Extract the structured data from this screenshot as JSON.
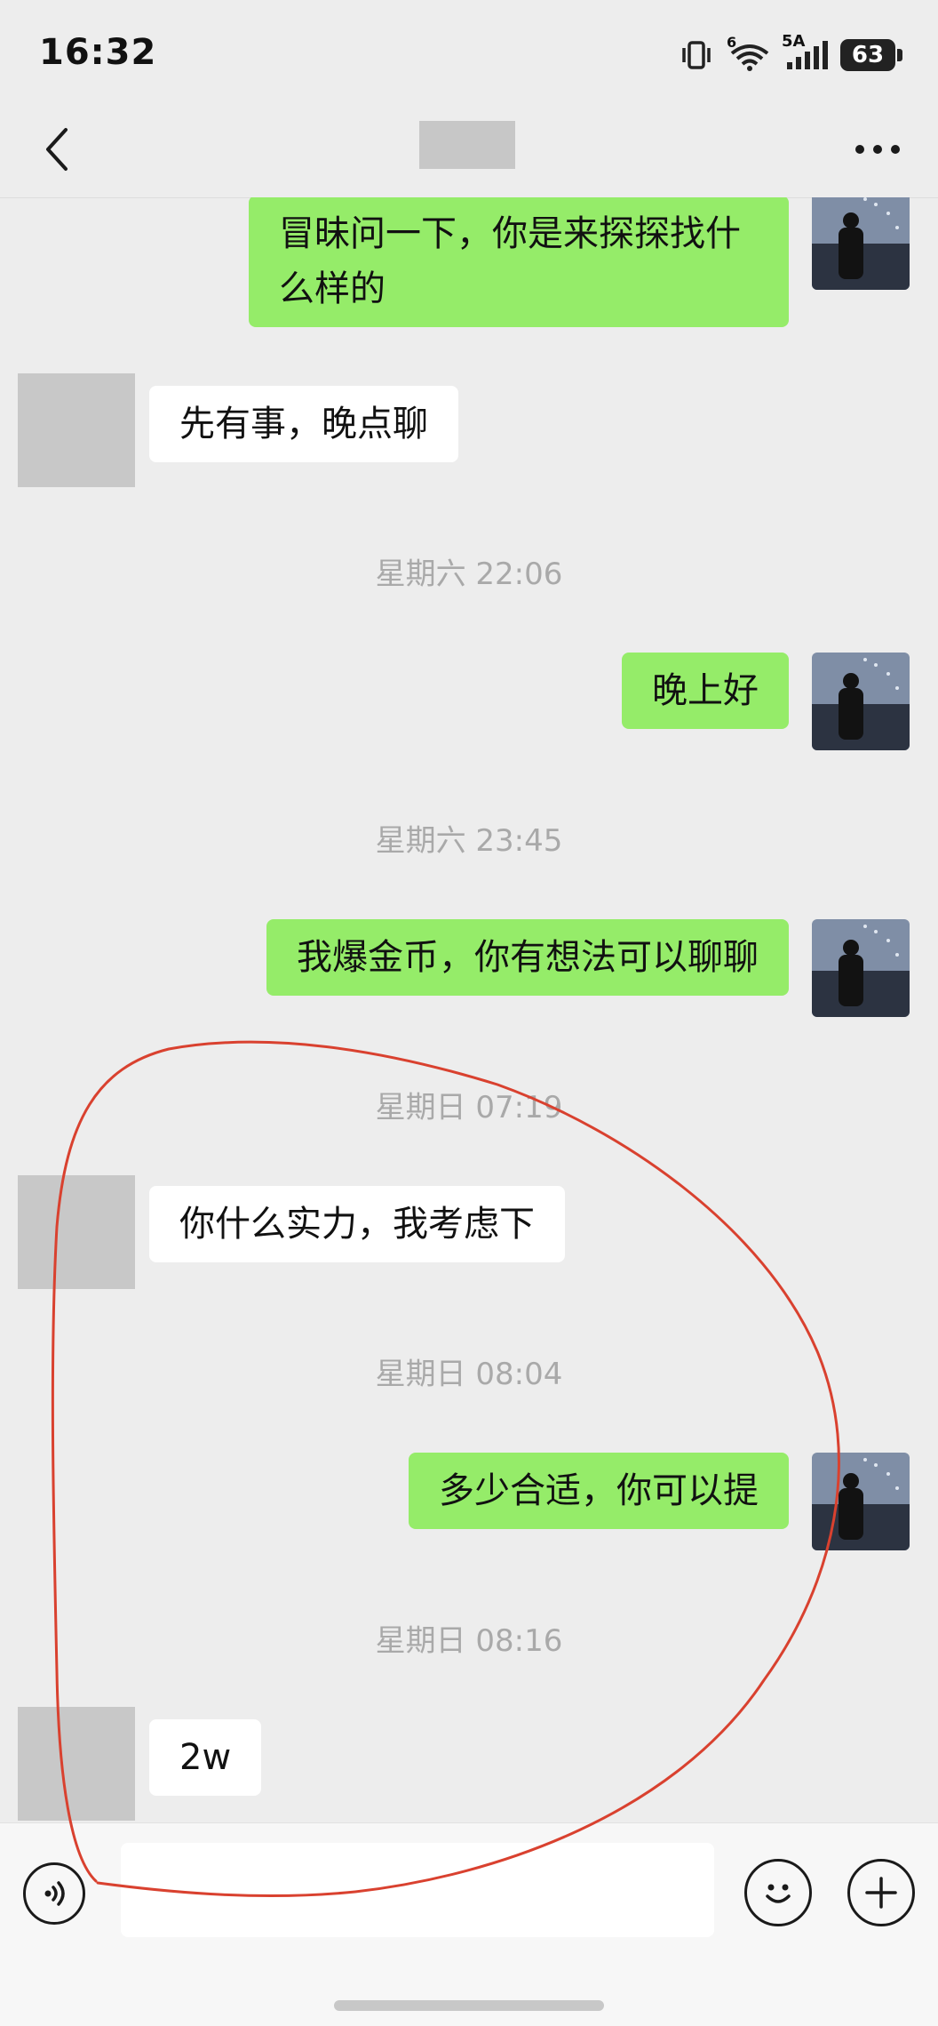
{
  "status_bar": {
    "time": "16:32",
    "wifi_badge": "6",
    "network_label": "5A",
    "battery": "63",
    "icons": [
      "vibrate-icon",
      "wifi-icon",
      "signal-icon",
      "battery-icon"
    ]
  },
  "nav": {
    "back_icon": "chevron-left-icon",
    "title": "",
    "more_icon": "more-dots-icon"
  },
  "messages": [
    {
      "side": "out",
      "text_lines": [
        "冒昧问一下，你是来探探找什",
        "么样的"
      ]
    },
    {
      "side": "in",
      "text": "先有事，晚点聊"
    },
    {
      "type": "timestamp",
      "text": "星期六 22:06"
    },
    {
      "side": "out",
      "text": "晚上好"
    },
    {
      "type": "timestamp",
      "text": "星期六 23:45"
    },
    {
      "side": "out",
      "text": "我爆金币，你有想法可以聊聊"
    },
    {
      "type": "timestamp",
      "text": "星期日 07:19"
    },
    {
      "side": "in",
      "text": "你什么实力，我考虑下"
    },
    {
      "type": "timestamp",
      "text": "星期日 08:04"
    },
    {
      "side": "out",
      "text": "多少合适，你可以提"
    },
    {
      "type": "timestamp",
      "text": "星期日 08:16"
    },
    {
      "side": "in",
      "text": "2w"
    }
  ],
  "input_bar": {
    "voice_icon": "voice-icon",
    "input_value": "",
    "emoji_icon": "emoji-icon",
    "plus_icon": "plus-icon"
  },
  "colors": {
    "background": "#ededed",
    "outgoing_bubble": "#95ec69",
    "incoming_bubble": "#ffffff",
    "timestamp_text": "#a9a9a9",
    "annotation_stroke": "#d9412f"
  }
}
